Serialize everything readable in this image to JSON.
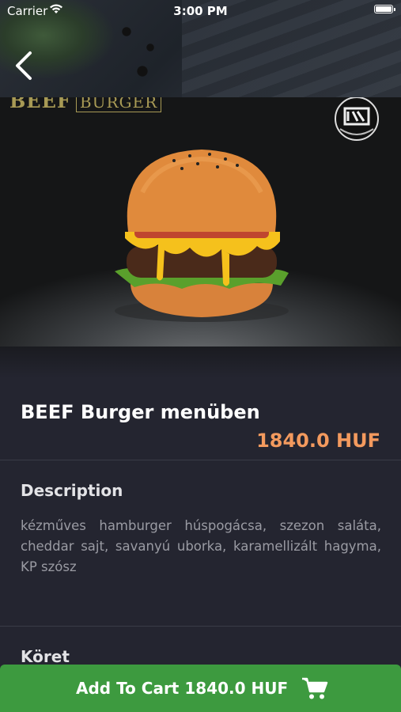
{
  "status_bar": {
    "carrier": "Carrier",
    "time": "3:00 PM"
  },
  "product_image": {
    "brand_word": "BEEF",
    "brand_boxed": "BURGER"
  },
  "product": {
    "name": "BEEF Burger menüben",
    "price": "1840.0 HUF"
  },
  "description": {
    "title": "Description",
    "text": "kézműves hamburger húspogácsa, szezon saláta, cheddar sajt, savanyú uborka, karamellizált hagyma, KP szósz"
  },
  "side": {
    "title": "Köret"
  },
  "cart": {
    "label": "Add To Cart 1840.0 HUF"
  },
  "colors": {
    "background": "#242530",
    "price": "#f39a5e",
    "cart_button": "#3d9a3f"
  },
  "icons": [
    "wifi-icon",
    "battery-icon",
    "back-chevron-icon",
    "brand-logo",
    "cart-icon"
  ]
}
